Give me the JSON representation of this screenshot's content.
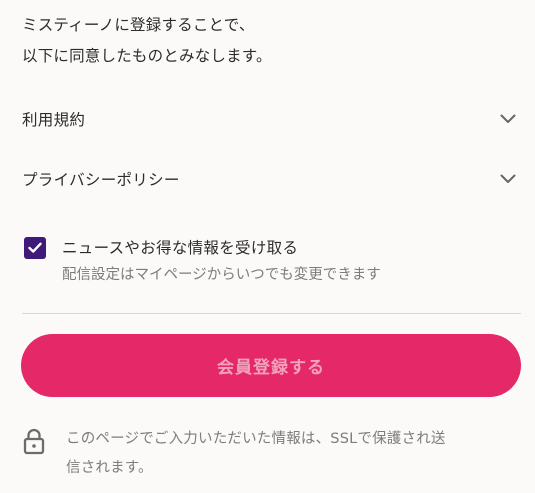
{
  "intro": {
    "line1": "ミスティーノに登録することで、",
    "line2": "以下に同意したものとみなします。"
  },
  "accordions": [
    {
      "label": "利用規約",
      "icon": "chevron-down-icon"
    },
    {
      "label": "プライバシーポリシー",
      "icon": "chevron-down-icon"
    }
  ],
  "newsletter": {
    "checked": true,
    "label": "ニュースやお得な情報を受け取る",
    "sublabel": "配信設定はマイページからいつでも変更できます",
    "checkbox_color": "#3f1a78"
  },
  "submit": {
    "label": "会員登録する",
    "background": "#e42868",
    "text_color": "#f3a2bd"
  },
  "ssl_note": {
    "icon": "lock-icon",
    "line1": "このページでご入力いただいた情報は、SSLで保護され送",
    "line2": "信されます。"
  }
}
